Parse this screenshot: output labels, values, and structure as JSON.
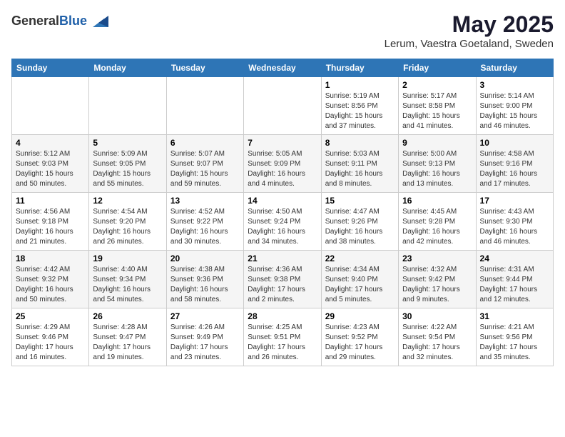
{
  "header": {
    "logo_line1": "General",
    "logo_line2": "Blue",
    "main_title": "May 2025",
    "subtitle": "Lerum, Vaestra Goetaland, Sweden"
  },
  "weekdays": [
    "Sunday",
    "Monday",
    "Tuesday",
    "Wednesday",
    "Thursday",
    "Friday",
    "Saturday"
  ],
  "weeks": [
    [
      {
        "day": "",
        "info": ""
      },
      {
        "day": "",
        "info": ""
      },
      {
        "day": "",
        "info": ""
      },
      {
        "day": "",
        "info": ""
      },
      {
        "day": "1",
        "info": "Sunrise: 5:19 AM\nSunset: 8:56 PM\nDaylight: 15 hours\nand 37 minutes."
      },
      {
        "day": "2",
        "info": "Sunrise: 5:17 AM\nSunset: 8:58 PM\nDaylight: 15 hours\nand 41 minutes."
      },
      {
        "day": "3",
        "info": "Sunrise: 5:14 AM\nSunset: 9:00 PM\nDaylight: 15 hours\nand 46 minutes."
      }
    ],
    [
      {
        "day": "4",
        "info": "Sunrise: 5:12 AM\nSunset: 9:03 PM\nDaylight: 15 hours\nand 50 minutes."
      },
      {
        "day": "5",
        "info": "Sunrise: 5:09 AM\nSunset: 9:05 PM\nDaylight: 15 hours\nand 55 minutes."
      },
      {
        "day": "6",
        "info": "Sunrise: 5:07 AM\nSunset: 9:07 PM\nDaylight: 15 hours\nand 59 minutes."
      },
      {
        "day": "7",
        "info": "Sunrise: 5:05 AM\nSunset: 9:09 PM\nDaylight: 16 hours\nand 4 minutes."
      },
      {
        "day": "8",
        "info": "Sunrise: 5:03 AM\nSunset: 9:11 PM\nDaylight: 16 hours\nand 8 minutes."
      },
      {
        "day": "9",
        "info": "Sunrise: 5:00 AM\nSunset: 9:13 PM\nDaylight: 16 hours\nand 13 minutes."
      },
      {
        "day": "10",
        "info": "Sunrise: 4:58 AM\nSunset: 9:16 PM\nDaylight: 16 hours\nand 17 minutes."
      }
    ],
    [
      {
        "day": "11",
        "info": "Sunrise: 4:56 AM\nSunset: 9:18 PM\nDaylight: 16 hours\nand 21 minutes."
      },
      {
        "day": "12",
        "info": "Sunrise: 4:54 AM\nSunset: 9:20 PM\nDaylight: 16 hours\nand 26 minutes."
      },
      {
        "day": "13",
        "info": "Sunrise: 4:52 AM\nSunset: 9:22 PM\nDaylight: 16 hours\nand 30 minutes."
      },
      {
        "day": "14",
        "info": "Sunrise: 4:50 AM\nSunset: 9:24 PM\nDaylight: 16 hours\nand 34 minutes."
      },
      {
        "day": "15",
        "info": "Sunrise: 4:47 AM\nSunset: 9:26 PM\nDaylight: 16 hours\nand 38 minutes."
      },
      {
        "day": "16",
        "info": "Sunrise: 4:45 AM\nSunset: 9:28 PM\nDaylight: 16 hours\nand 42 minutes."
      },
      {
        "day": "17",
        "info": "Sunrise: 4:43 AM\nSunset: 9:30 PM\nDaylight: 16 hours\nand 46 minutes."
      }
    ],
    [
      {
        "day": "18",
        "info": "Sunrise: 4:42 AM\nSunset: 9:32 PM\nDaylight: 16 hours\nand 50 minutes."
      },
      {
        "day": "19",
        "info": "Sunrise: 4:40 AM\nSunset: 9:34 PM\nDaylight: 16 hours\nand 54 minutes."
      },
      {
        "day": "20",
        "info": "Sunrise: 4:38 AM\nSunset: 9:36 PM\nDaylight: 16 hours\nand 58 minutes."
      },
      {
        "day": "21",
        "info": "Sunrise: 4:36 AM\nSunset: 9:38 PM\nDaylight: 17 hours\nand 2 minutes."
      },
      {
        "day": "22",
        "info": "Sunrise: 4:34 AM\nSunset: 9:40 PM\nDaylight: 17 hours\nand 5 minutes."
      },
      {
        "day": "23",
        "info": "Sunrise: 4:32 AM\nSunset: 9:42 PM\nDaylight: 17 hours\nand 9 minutes."
      },
      {
        "day": "24",
        "info": "Sunrise: 4:31 AM\nSunset: 9:44 PM\nDaylight: 17 hours\nand 12 minutes."
      }
    ],
    [
      {
        "day": "25",
        "info": "Sunrise: 4:29 AM\nSunset: 9:46 PM\nDaylight: 17 hours\nand 16 minutes."
      },
      {
        "day": "26",
        "info": "Sunrise: 4:28 AM\nSunset: 9:47 PM\nDaylight: 17 hours\nand 19 minutes."
      },
      {
        "day": "27",
        "info": "Sunrise: 4:26 AM\nSunset: 9:49 PM\nDaylight: 17 hours\nand 23 minutes."
      },
      {
        "day": "28",
        "info": "Sunrise: 4:25 AM\nSunset: 9:51 PM\nDaylight: 17 hours\nand 26 minutes."
      },
      {
        "day": "29",
        "info": "Sunrise: 4:23 AM\nSunset: 9:52 PM\nDaylight: 17 hours\nand 29 minutes."
      },
      {
        "day": "30",
        "info": "Sunrise: 4:22 AM\nSunset: 9:54 PM\nDaylight: 17 hours\nand 32 minutes."
      },
      {
        "day": "31",
        "info": "Sunrise: 4:21 AM\nSunset: 9:56 PM\nDaylight: 17 hours\nand 35 minutes."
      }
    ]
  ]
}
